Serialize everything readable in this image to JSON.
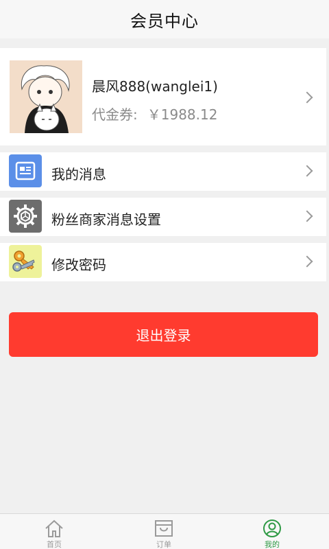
{
  "header": {
    "title": "会员中心"
  },
  "profile": {
    "name": "晨风888(wanglei1)",
    "voucher_label": "代金券:",
    "voucher_value": "￥1988.12"
  },
  "menu": {
    "items": [
      {
        "label": "我的消息",
        "icon": "message-icon"
      },
      {
        "label": "粉丝商家消息设置",
        "icon": "gear-icon"
      },
      {
        "label": "修改密码",
        "icon": "keys-icon"
      }
    ]
  },
  "logout": {
    "label": "退出登录"
  },
  "tabbar": {
    "tabs": [
      {
        "label": "首页",
        "icon": "home-icon",
        "active": false
      },
      {
        "label": "订单",
        "icon": "cart-icon",
        "active": false
      },
      {
        "label": "我的",
        "icon": "user-icon",
        "active": true
      }
    ]
  },
  "colors": {
    "accent_red": "#ff3b2f",
    "active_tab": "#2f9a45",
    "background": "#f0f0f0",
    "message_icon_bg": "#5b8fe8",
    "gear_icon_bg": "#6d6d6d",
    "keys_icon_bg": "#eef29a"
  }
}
